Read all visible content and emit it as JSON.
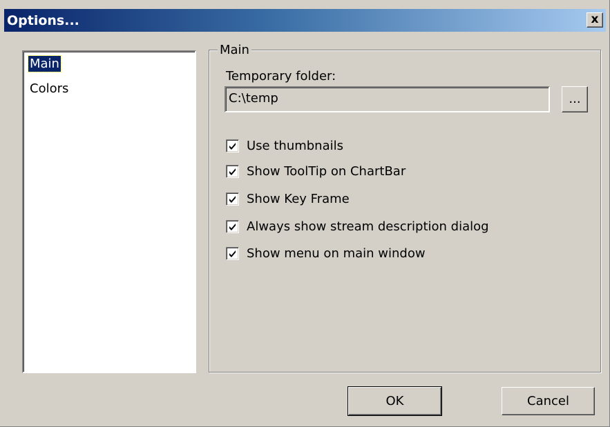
{
  "window": {
    "title": "Options...",
    "close_label": "x"
  },
  "sidebar": {
    "items": [
      {
        "label": "Main",
        "selected": true
      },
      {
        "label": "Colors",
        "selected": false
      }
    ]
  },
  "main": {
    "group_title": "Main",
    "temp_folder_label": "Temporary folder:",
    "temp_folder_value": "C:\\temp",
    "browse_label": "...",
    "options": [
      {
        "label": "Use thumbnails",
        "checked": true
      },
      {
        "label": "Show ToolTip on ChartBar",
        "checked": true
      },
      {
        "label": "Show Key Frame",
        "checked": true
      },
      {
        "label": "Always show stream description dialog",
        "checked": true
      },
      {
        "label": "Show menu on main window",
        "checked": true
      }
    ]
  },
  "buttons": {
    "ok_label": "OK",
    "cancel_label": "Cancel"
  },
  "colors": {
    "titlebar_start": "#0a246a",
    "titlebar_end": "#a6caf0",
    "face": "#d4d0c8",
    "selection": "#0a246a"
  }
}
